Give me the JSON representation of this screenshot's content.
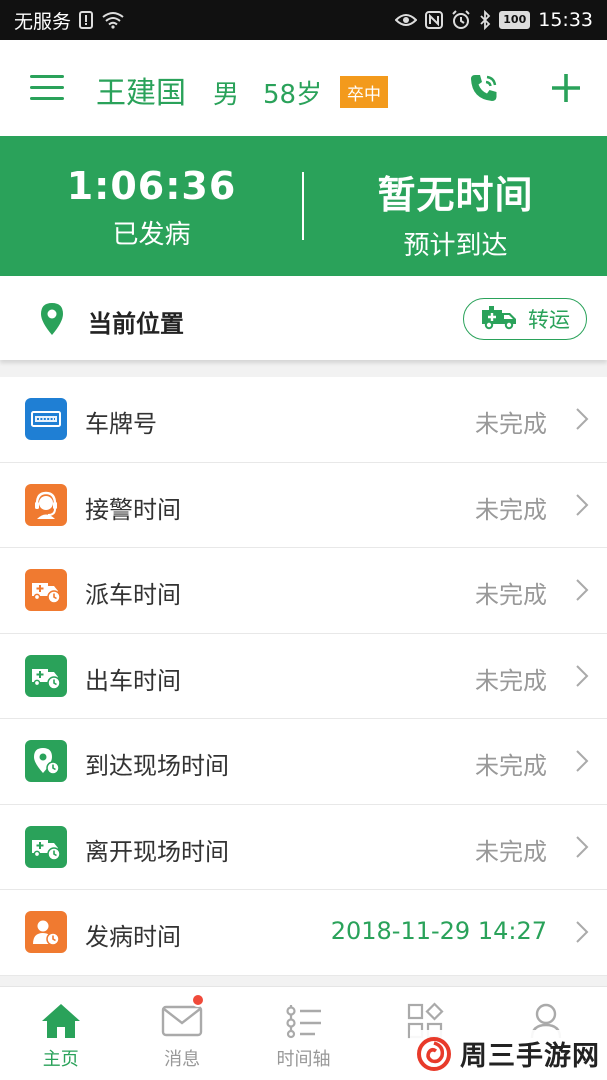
{
  "status_bar": {
    "carrier": "无服务",
    "battery": "100",
    "time": "15:33"
  },
  "header": {
    "name": "王建国",
    "sex": "男",
    "age": "58岁",
    "badge": "卒中",
    "accent": "#2aa25a",
    "badge_color": "#f39a1c"
  },
  "banner": {
    "elapsed_value": "1:06:36",
    "elapsed_label": "已发病",
    "eta_value": "暂无时间",
    "eta_label": "预计到达"
  },
  "location": {
    "label": "当前位置",
    "transfer_label": "转运"
  },
  "list": [
    {
      "label": "车牌号",
      "status": "未完成",
      "icon": "license-plate-icon",
      "color": "#1f7fd4"
    },
    {
      "label": "接警时间",
      "status": "未完成",
      "icon": "operator-headset-icon",
      "color": "#f07a30"
    },
    {
      "label": "派车时间",
      "status": "未完成",
      "icon": "ambulance-clock-icon",
      "color": "#f07a30"
    },
    {
      "label": "出车时间",
      "status": "未完成",
      "icon": "ambulance-clock-icon",
      "color": "#2aa25a"
    },
    {
      "label": "到达现场时间",
      "status": "未完成",
      "icon": "location-clock-icon",
      "color": "#2aa25a"
    },
    {
      "label": "离开现场时间",
      "status": "未完成",
      "icon": "ambulance-clock-icon",
      "color": "#2aa25a"
    },
    {
      "label": "发病时间",
      "status": "2018-11-29 14:27",
      "icon": "person-clock-icon",
      "color": "#f07a30"
    }
  ],
  "nav": [
    {
      "label": "主页",
      "icon": "home-icon"
    },
    {
      "label": "消息",
      "icon": "mail-icon"
    },
    {
      "label": "时间轴",
      "icon": "timeline-icon"
    },
    {
      "label": "",
      "icon": "apps-icon"
    },
    {
      "label": "",
      "icon": "user-icon"
    }
  ],
  "watermark": {
    "text": "周三手游网"
  }
}
